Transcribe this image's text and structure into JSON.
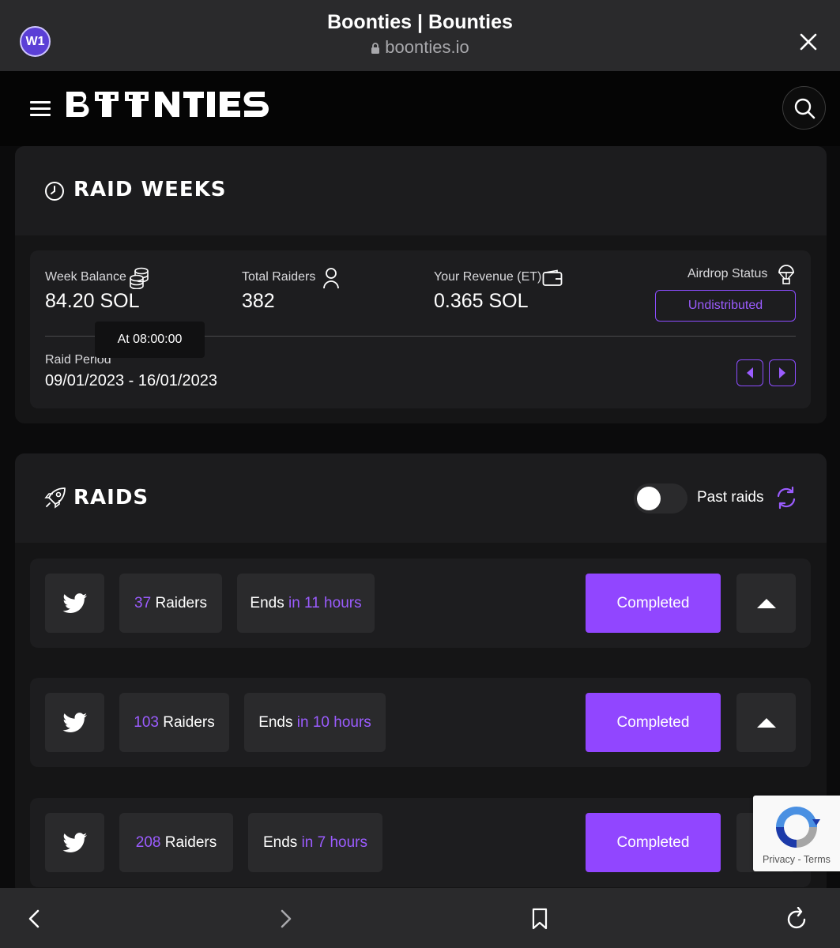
{
  "browser": {
    "profile_badge": "W1",
    "page_title": "Boonties | Bounties",
    "url": "boonties.io"
  },
  "site": {
    "logo_text": "BOONTIES"
  },
  "raid_weeks": {
    "title": "RAID WEEKS",
    "week_balance_label": "Week Balance",
    "week_balance_value": "84.20 SOL",
    "total_raiders_label": "Total Raiders",
    "total_raiders_value": "382",
    "revenue_label": "Your Revenue (ET)",
    "revenue_value": "0.365 SOL",
    "airdrop_label": "Airdrop Status",
    "airdrop_status": "Undistributed",
    "tooltip": "At 08:00:00",
    "raid_period_label": "Raid Period",
    "raid_period_value": "09/01/2023 - 16/01/2023"
  },
  "raids": {
    "title": "RAIDS",
    "past_raids_label": "Past raids",
    "past_raids_enabled": false,
    "items": [
      {
        "raiders_count": "37",
        "raiders_label": "Raiders",
        "ends_label": "Ends",
        "ends_in": "in 11 hours",
        "status": "Completed"
      },
      {
        "raiders_count": "103",
        "raiders_label": "Raiders",
        "ends_label": "Ends",
        "ends_in": "in 10 hours",
        "status": "Completed"
      },
      {
        "raiders_count": "208",
        "raiders_label": "Raiders",
        "ends_label": "Ends",
        "ends_in": "in 7 hours",
        "status": "Completed"
      }
    ]
  },
  "recaptcha": {
    "text": "Privacy - Terms"
  },
  "colors": {
    "accent": "#9146ff",
    "accent_text": "#9b5cff",
    "background": "#0b0b0c",
    "panel": "#151516",
    "card": "#1d1d1f"
  }
}
